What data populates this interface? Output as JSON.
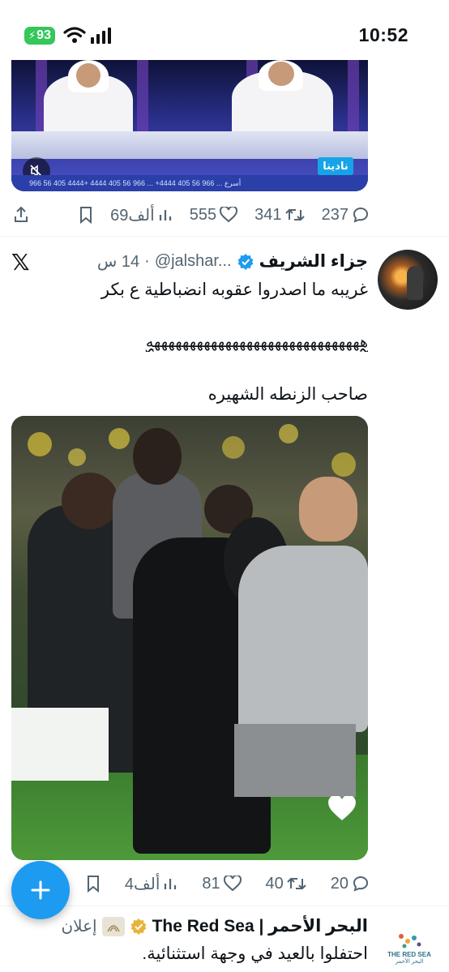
{
  "status_bar": {
    "battery": "93",
    "time": "10:52"
  },
  "tweet1": {
    "ticker": "966 56 405 4444+ أسرع ... 966 56 405 4444+ ... 966 56 405 4444",
    "channel_logo": "نادينا",
    "actions": {
      "replies": "237",
      "retweets": "341",
      "likes": "555",
      "views": "69ألف"
    }
  },
  "tweet2": {
    "platform_icon": "x-logo-icon",
    "name": "جزاء الشريف",
    "handle": "@jalshar...",
    "time": "14 س",
    "line1": "غريبه ما اصدروا عقوبه انضباطية ع بكر",
    "line2": "ههههههههههههههههههههههههههههههه",
    "line3": "صاحب الزنطه الشهيره",
    "actions": {
      "replies": "20",
      "retweets": "40",
      "likes": "81",
      "views": "4ألف"
    }
  },
  "ad": {
    "name": "البحر الأحمر | The Red Sea",
    "label": "إعلان",
    "text": "احتفلوا بالعيد في وجهة استثنائية.",
    "avatar_line1": "THE RED SEA",
    "avatar_line2": "البحر الأحمر"
  },
  "colors": {
    "accent": "#1d9bf0",
    "muted": "#536471",
    "battery": "#34c759",
    "verified_gold": "#e8b33a"
  }
}
